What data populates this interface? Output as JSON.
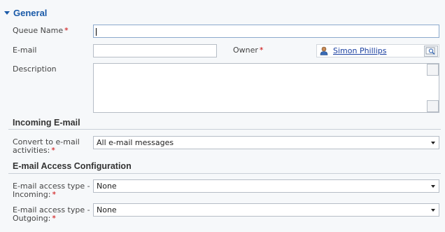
{
  "section": {
    "title": "General"
  },
  "queue_name": {
    "label": "Queue Name",
    "value": ""
  },
  "email": {
    "label": "E-mail",
    "value": ""
  },
  "owner": {
    "label": "Owner",
    "value": "Simon Phillips"
  },
  "description": {
    "label": "Description",
    "value": ""
  },
  "required_mark": "*",
  "incoming": {
    "title": "Incoming E-mail",
    "convert_label_1": "Convert to e-mail",
    "convert_label_2": "activities:",
    "convert_value": "All e-mail messages"
  },
  "access": {
    "title": "E-mail Access Configuration",
    "incoming_label_1": "E-mail access type -",
    "incoming_label_2": "Incoming:",
    "incoming_value": "None",
    "outgoing_label_1": "E-mail access type -",
    "outgoing_label_2": "Outgoing:",
    "outgoing_value": "None"
  },
  "icons": {
    "owner": "user-icon",
    "lookup": "lookup-search-icon"
  },
  "colors": {
    "accent": "#1a5aa8",
    "required": "#cc0000",
    "link": "#1a3fa0"
  }
}
